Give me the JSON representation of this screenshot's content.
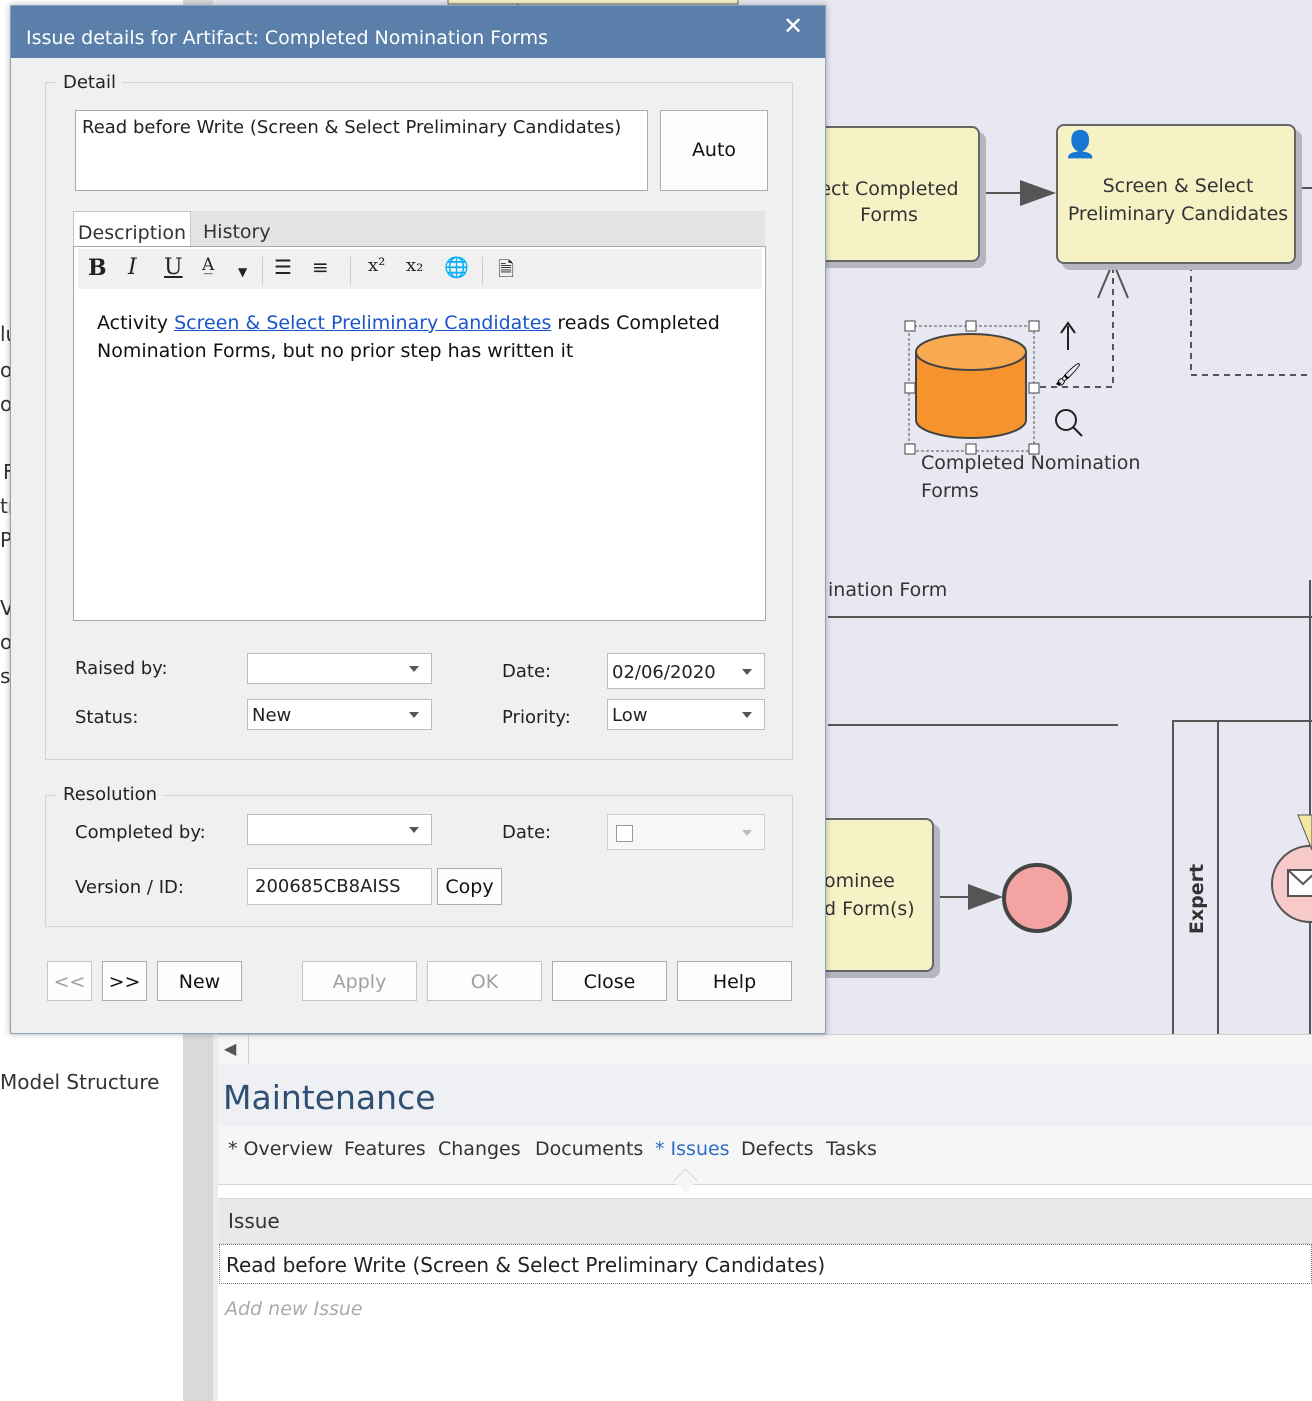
{
  "dialog": {
    "title": "Issue details for Artifact: Completed Nomination Forms",
    "detail_group": "Detail",
    "detail_text": "Read before Write (Screen & Select Preliminary Candidates)",
    "auto_button": "Auto",
    "tabs": {
      "description": "Description",
      "history": "History"
    },
    "description_prefix": "Activity ",
    "description_link": "Screen & Select Preliminary Candidates",
    "description_suffix": " reads Completed Nomination Forms, but no prior step has written it",
    "raised_by_label": "Raised by:",
    "raised_by_value": "",
    "date_label": "Date:",
    "date_value": "02/06/2020",
    "status_label": "Status:",
    "status_value": "New",
    "priority_label": "Priority:",
    "priority_value": "Low",
    "resolution_group": "Resolution",
    "completed_by_label": "Completed by:",
    "completed_by_value": "",
    "res_date_label": "Date:",
    "version_label": "Version / ID:",
    "version_value": "200685CB8AISS",
    "copy_button": "Copy",
    "buttons": {
      "prev": "<<",
      "next": ">>",
      "new": "New",
      "apply": "Apply",
      "ok": "OK",
      "close": "Close",
      "help": "Help"
    }
  },
  "diagram": {
    "task1_label_line1": "ect Completed",
    "task1_label_line2": "Forms",
    "task2_label_line1": "Screen & Select",
    "task2_label_line2": "Preliminary Candidates",
    "artifact_label_line1": "Completed Nomination",
    "artifact_label_line2": "Forms",
    "lane_fragment": "ination Form",
    "task3_label_line1": "ominee",
    "task3_label_line2": "d Form(s)",
    "lane_label": "Expert",
    "artifact_color": "#f7932d",
    "end_event_color": "#f4a3a3"
  },
  "left_fragments": [
    "lu",
    "ol",
    "ov",
    "F",
    "tr",
    "P",
    "V",
    "or",
    "s"
  ],
  "model_structure": "Model Structure",
  "maintenance": {
    "title": "Maintenance",
    "tabs": [
      "* Overview",
      "Features",
      "Changes",
      "Documents",
      "* Issues",
      "Defects",
      "Tasks"
    ],
    "active_tab": "* Issues",
    "column_header": "Issue",
    "rows": [
      "Read before Write (Screen & Select Preliminary Candidates)"
    ],
    "add_placeholder": "Add new Issue"
  }
}
